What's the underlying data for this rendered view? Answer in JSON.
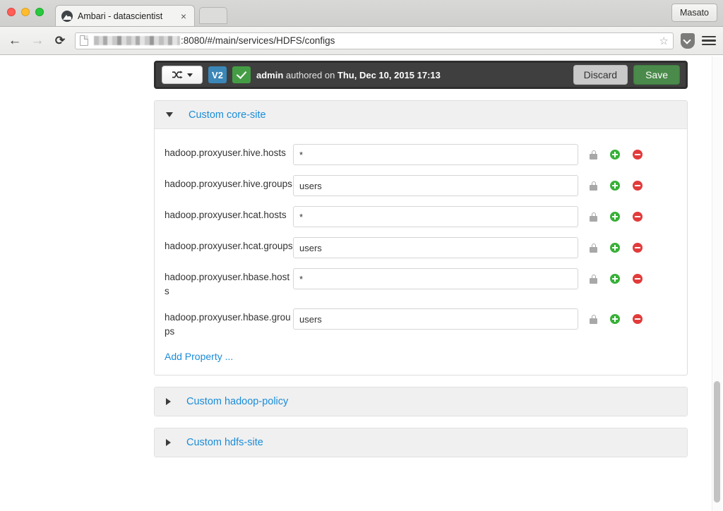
{
  "browser": {
    "tab": {
      "title": "Ambari - datascientist",
      "close_label": "×",
      "favicon_name": "ambari-favicon"
    },
    "new_tab_label": "",
    "profile_button": "Masato",
    "nav": {
      "back": "←",
      "forward": "→",
      "reload": "⟳"
    },
    "url": {
      "host_redacted": "",
      "visible_text": ":8080/#/main/services/HDFS/configs"
    },
    "bookmark_star": "☆"
  },
  "version_bar": {
    "compare_caret": "",
    "version_badge": "V2",
    "current_check": "",
    "authored_prefix": "admin",
    "authored_mid": " authored on ",
    "authored_date": "Thu, Dec 10, 2015 17:13",
    "discard_label": "Discard",
    "save_label": "Save"
  },
  "panels": [
    {
      "id": "custom-core-site",
      "title": "Custom core-site",
      "expanded": true,
      "add_property_label": "Add Property ...",
      "properties": [
        {
          "name": "hadoop.proxyuser.hive.hosts",
          "value": "*"
        },
        {
          "name": "hadoop.proxyuser.hive.groups",
          "value": "users"
        },
        {
          "name": "hadoop.proxyuser.hcat.hosts",
          "value": "*"
        },
        {
          "name": "hadoop.proxyuser.hcat.groups",
          "value": "users"
        },
        {
          "name": "hadoop.proxyuser.hbase.hosts",
          "value": "*"
        },
        {
          "name": "hadoop.proxyuser.hbase.groups",
          "value": "users"
        }
      ]
    },
    {
      "id": "custom-hadoop-policy",
      "title": "Custom hadoop-policy",
      "expanded": false
    },
    {
      "id": "custom-hdfs-site",
      "title": "Custom hdfs-site",
      "expanded": false
    }
  ],
  "colors": {
    "link_blue": "#1a8cd8",
    "save_green": "#4a8a4a",
    "badge_blue": "#3b87b8",
    "badge_green": "#449d44",
    "toolbar_dark": "#3f3f3f",
    "plus_green": "#38b038",
    "minus_red": "#e23b3b",
    "lock_gray": "#a8a8a8"
  }
}
